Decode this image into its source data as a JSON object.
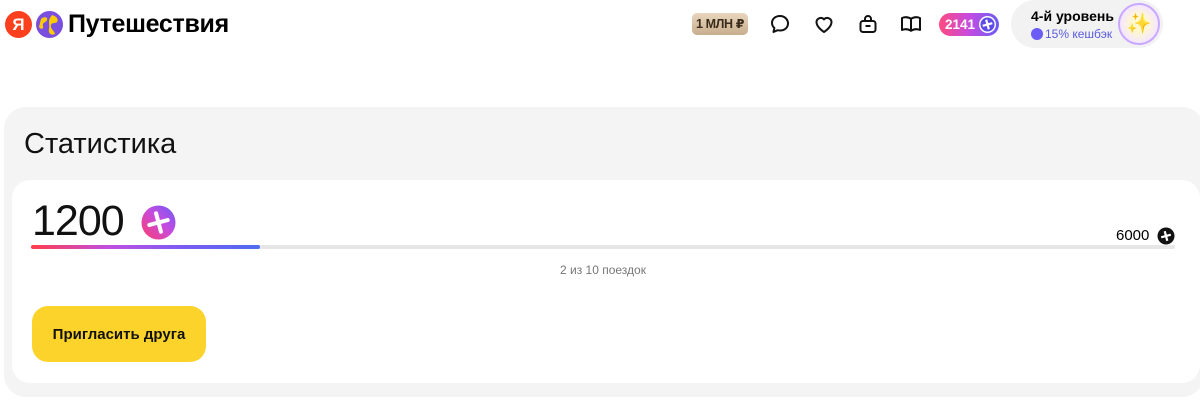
{
  "header": {
    "logo_letter": "Я",
    "brand": "Путешествия",
    "promo_badge": "1 МЛН ₽",
    "icons": [
      "chat-icon",
      "heart-icon",
      "bag-icon",
      "book-icon"
    ],
    "points": "2141",
    "level": {
      "title": "4-й уровень",
      "cashback": "15% кешбэк",
      "avatar_glyph": "✨"
    }
  },
  "stats": {
    "title": "Статистика",
    "current_points": "1200",
    "max_points": "6000",
    "progress_label": "2 из 10 поездок",
    "progress_fraction": 0.2,
    "invite_button": "Пригласить друга"
  },
  "colors": {
    "accent_yellow": "#fcd32a",
    "brand_red": "#fc3f1d",
    "plus_gradient": [
      "#ff4a7f",
      "#c54be0",
      "#6b5cf5"
    ]
  }
}
